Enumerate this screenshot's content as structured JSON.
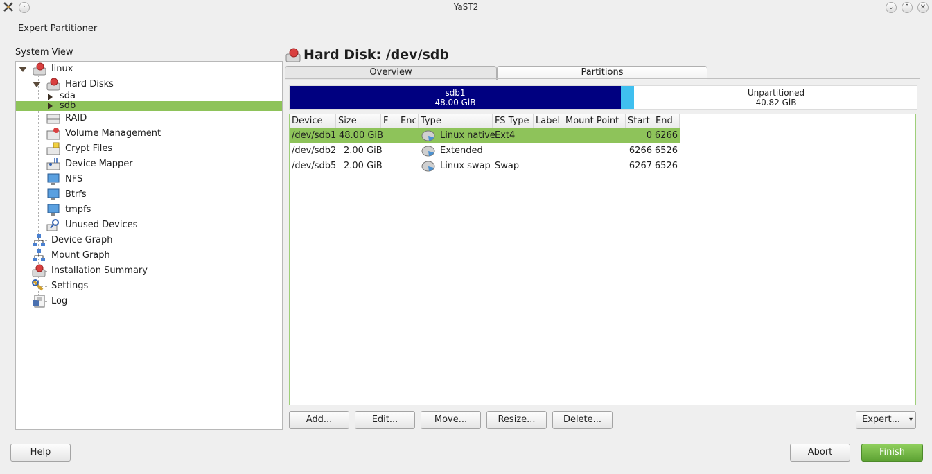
{
  "window": {
    "title": "YaST2"
  },
  "app_heading": "Expert Partitioner",
  "system_view": {
    "label": "System View",
    "tree": [
      {
        "label": "linux",
        "icon": "harddisk-icon"
      },
      {
        "label": "Hard Disks",
        "icon": "harddisk-icon"
      },
      {
        "label": "sda",
        "icon": ""
      },
      {
        "label": "sdb",
        "icon": ""
      },
      {
        "label": "RAID",
        "icon": "raid-icon"
      },
      {
        "label": "Volume Management",
        "icon": "lvm-icon"
      },
      {
        "label": "Crypt Files",
        "icon": "crypt-icon"
      },
      {
        "label": "Device Mapper",
        "icon": "device-mapper-icon"
      },
      {
        "label": "NFS",
        "icon": "nfs-icon"
      },
      {
        "label": "Btrfs",
        "icon": "btrfs-icon"
      },
      {
        "label": "tmpfs",
        "icon": "tmpfs-icon"
      },
      {
        "label": "Unused Devices",
        "icon": "unused-devices-icon"
      },
      {
        "label": "Device Graph",
        "icon": "graph-icon"
      },
      {
        "label": "Mount Graph",
        "icon": "graph-icon"
      },
      {
        "label": "Installation Summary",
        "icon": "summary-icon"
      },
      {
        "label": "Settings",
        "icon": "settings-icon"
      },
      {
        "label": "Log",
        "icon": "log-icon"
      }
    ],
    "selected": "sdb"
  },
  "main": {
    "title": "Hard Disk: /dev/sdb",
    "tabs": [
      {
        "label": "Overview"
      },
      {
        "label": "Partitions"
      }
    ],
    "active_tab": "Partitions",
    "usage_bar": {
      "sdb1": {
        "name": "sdb1",
        "size": "48.00 GiB",
        "color": "#000080"
      },
      "extended": {
        "color": "#3fbfef"
      },
      "unpartitioned": {
        "name": "Unpartitioned",
        "size": "40.82 GiB"
      }
    },
    "table": {
      "headers": [
        "Device",
        "Size",
        "F",
        "Enc",
        "Type",
        "FS Type",
        "Label",
        "Mount Point",
        "Start",
        "End"
      ],
      "rows": [
        {
          "device": "/dev/sdb1",
          "size": "48.00 GiB",
          "f": "",
          "enc": "",
          "type": "Linux native",
          "fs_type": "Ext4",
          "label": "",
          "mount": "",
          "start": "0",
          "end": "6266"
        },
        {
          "device": "/dev/sdb2",
          "size": "2.00 GiB",
          "f": "",
          "enc": "",
          "type": "Extended",
          "fs_type": "",
          "label": "",
          "mount": "",
          "start": "6266",
          "end": "6526"
        },
        {
          "device": "/dev/sdb5",
          "size": "2.00 GiB",
          "f": "",
          "enc": "",
          "type": "Linux swap",
          "fs_type": "Swap",
          "label": "",
          "mount": "",
          "start": "6267",
          "end": "6526"
        }
      ],
      "selected_row": 0
    },
    "buttons": {
      "add": "Add...",
      "edit": "Edit...",
      "move": "Move...",
      "resize": "Resize...",
      "delete": "Delete...",
      "expert": "Expert..."
    }
  },
  "footer": {
    "help": "Help",
    "abort": "Abort",
    "finish": "Finish"
  },
  "colors": {
    "selection": "#8ec35a",
    "primary_button": "#6cb23e"
  }
}
